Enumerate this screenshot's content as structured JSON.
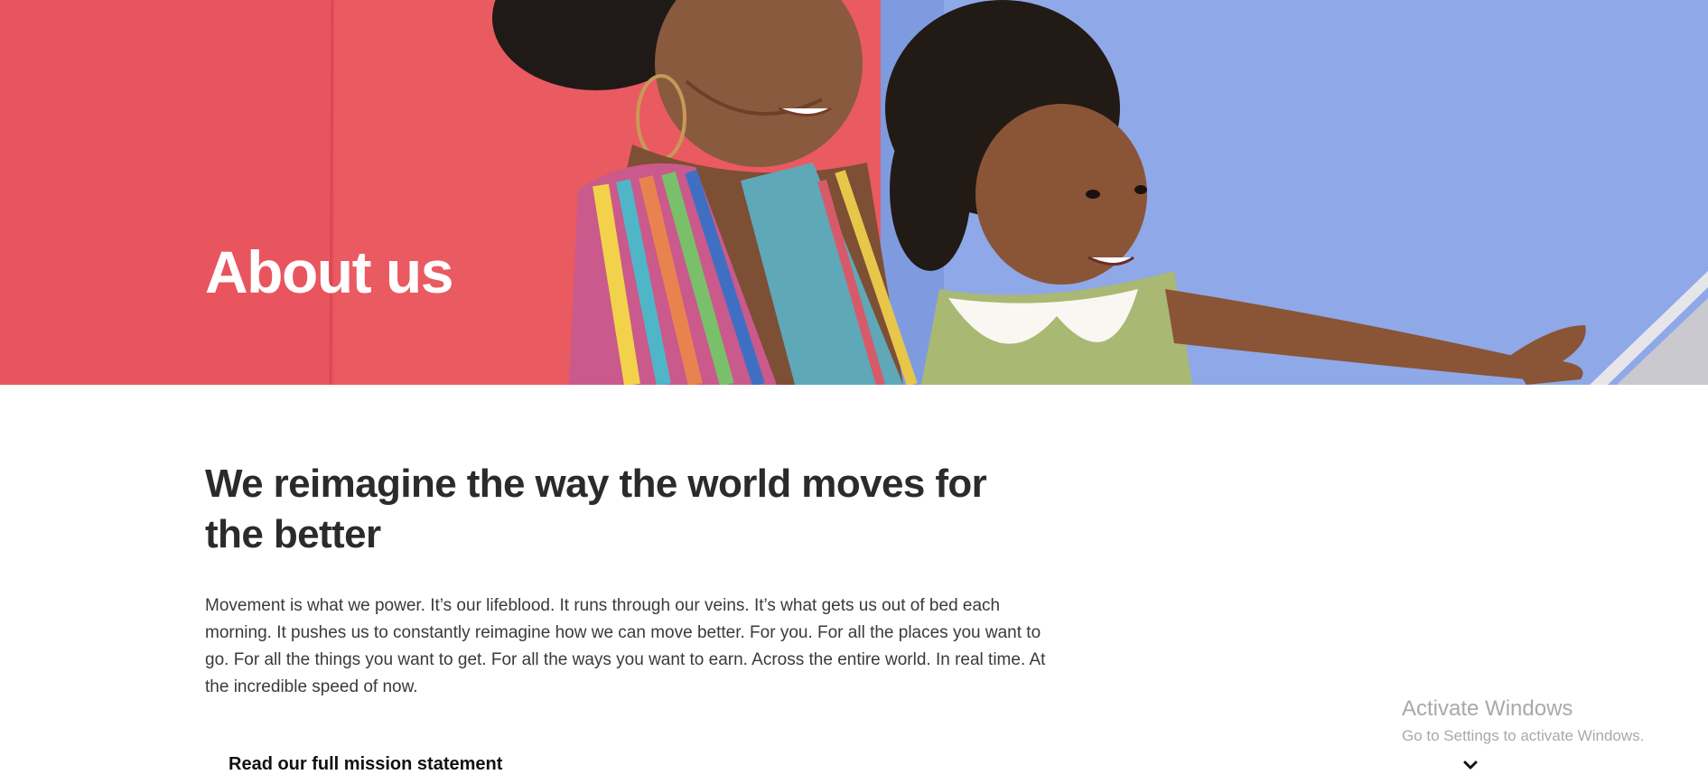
{
  "hero": {
    "title": "About us"
  },
  "main": {
    "headline": "We reimagine the way the world moves for the better",
    "body": "Movement is what we power. It’s our lifeblood. It runs through our veins. It’s what gets us out of bed each morning. It pushes us to constantly reimagine how we can move better. For you. For all the places you want to go. For all the things you want to get. For all the ways you want to earn. Across the entire world. In real time. At the incredible speed of now.",
    "accordion": {
      "label": "Read our full mission statement",
      "icon": "chevron-down-icon",
      "expanded": false
    }
  },
  "watermark": {
    "title": "Activate Windows",
    "subtitle": "Go to Settings to activate Windows."
  },
  "colors": {
    "hero_red": "#e9575e",
    "hero_blue": "#8ea7e6",
    "text_dark": "#2b2b2b",
    "watermark_gray": "#a9a9a9"
  }
}
